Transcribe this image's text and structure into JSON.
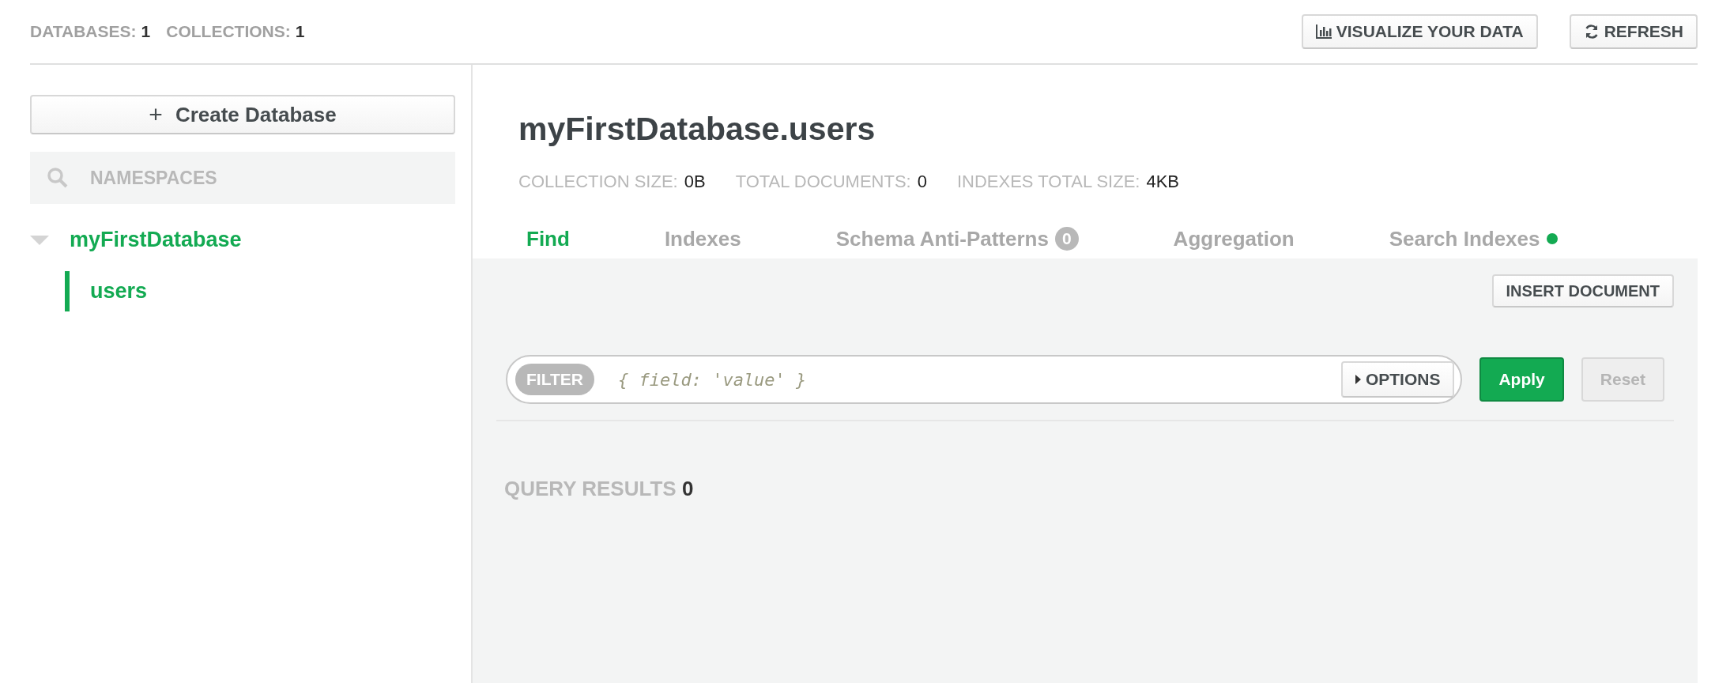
{
  "header": {
    "stats": [
      {
        "label": "DATABASES:",
        "value": "1"
      },
      {
        "label": "COLLECTIONS:",
        "value": "1"
      }
    ],
    "buttons": [
      {
        "kind": "chart",
        "label": "VISUALIZE YOUR DATA"
      },
      {
        "kind": "refresh",
        "label": "REFRESH"
      }
    ]
  },
  "sidebar": {
    "create_button": "Create Database",
    "create_icon": "+",
    "search": {
      "placeholder": "NAMESPACES"
    },
    "tree": [
      {
        "label": "myFirstDatabase",
        "expanded": true,
        "children": [
          {
            "label": "users",
            "selected": true
          }
        ]
      }
    ]
  },
  "collection": {
    "title": "myFirstDatabase.users",
    "stats": [
      {
        "label": "COLLECTION SIZE:",
        "value": "0B"
      },
      {
        "label": "TOTAL DOCUMENTS:",
        "value": "0"
      },
      {
        "label": "INDEXES TOTAL SIZE:",
        "value": "4KB"
      }
    ],
    "tabs": [
      {
        "label": "Find",
        "selected": true
      },
      {
        "label": "Indexes",
        "selected": false
      },
      {
        "label": "Schema Anti-Patterns",
        "selected": false,
        "badge": "0"
      },
      {
        "label": "Aggregation",
        "selected": false
      },
      {
        "label": "Search Indexes",
        "selected": false,
        "color": "#13aa52"
      }
    ],
    "insert_button": "INSERT DOCUMENT",
    "filter": {
      "label": "FILTER",
      "placeholder": "{ field: 'value' }",
      "options_button": "OPTIONS"
    },
    "apply_button": "Apply",
    "reset_button": {
      "label": "Reset",
      "disabled": true
    },
    "results": {
      "label": "QUERY RESULTS",
      "count": "0"
    }
  }
}
